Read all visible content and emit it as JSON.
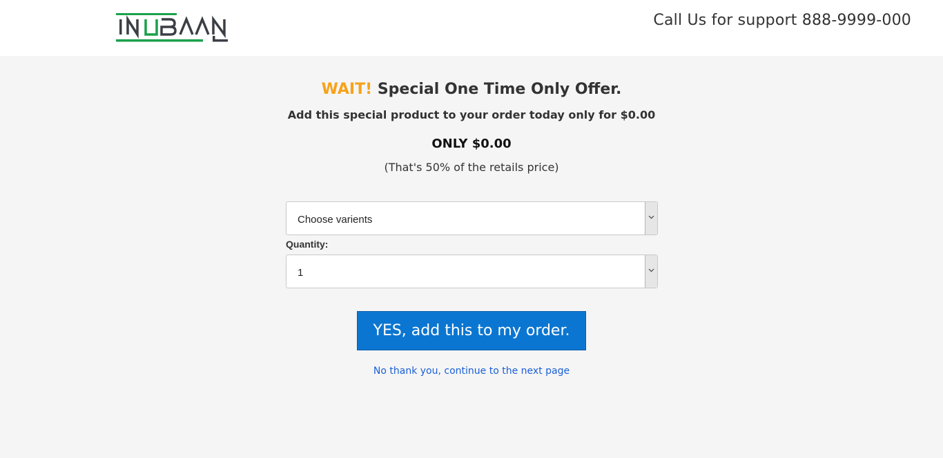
{
  "header": {
    "logo_text": "INUBAAN",
    "support_text": "Call Us for support 888-9999-000",
    "logo_colors": {
      "green": "#1aa14a",
      "dark": "#3b3f45"
    }
  },
  "offer": {
    "wait": "WAIT!",
    "headline": "Special One Time Only Offer.",
    "subline": "Add this special product to your order today only for $0.00",
    "price": "ONLY $0.00",
    "retail_note": "(That's 50% of the retails price)"
  },
  "form": {
    "variants_value": "Choose varients",
    "quantity_label": "Quantity:",
    "quantity_value": "1"
  },
  "actions": {
    "yes_button": "YES, add this to my order.",
    "no_link": "No thank you, continue to the next page"
  },
  "colors": {
    "accent_orange": "#f7a21b",
    "button_blue": "#0b76d1",
    "link_blue": "#1a5fd6"
  }
}
